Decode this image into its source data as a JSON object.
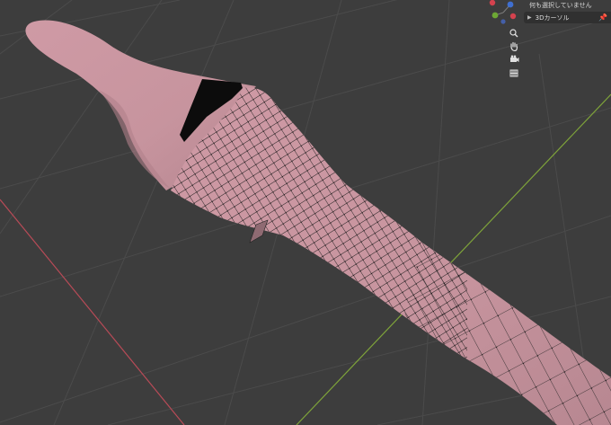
{
  "header": {
    "selection_status": "何も選択していません"
  },
  "sidebar_panel": {
    "section_title": "3Dカーソル",
    "expand_icon": "chevron-right-icon",
    "pin_icon": "pin-icon"
  },
  "navigation": {
    "zoom_icon": "magnifier-icon",
    "pan_icon": "hand-icon",
    "camera_icon": "camera-icon",
    "perspective_icon": "grid-icon"
  },
  "colors": {
    "background": "#3d3d3d",
    "grid_line": "#4a4a4a",
    "x_axis": "#b84b57",
    "y_axis": "#7ea33a",
    "mesh": "#c7949e",
    "mesh_shadow": "#a77983",
    "wire": "#1a1a1a"
  }
}
